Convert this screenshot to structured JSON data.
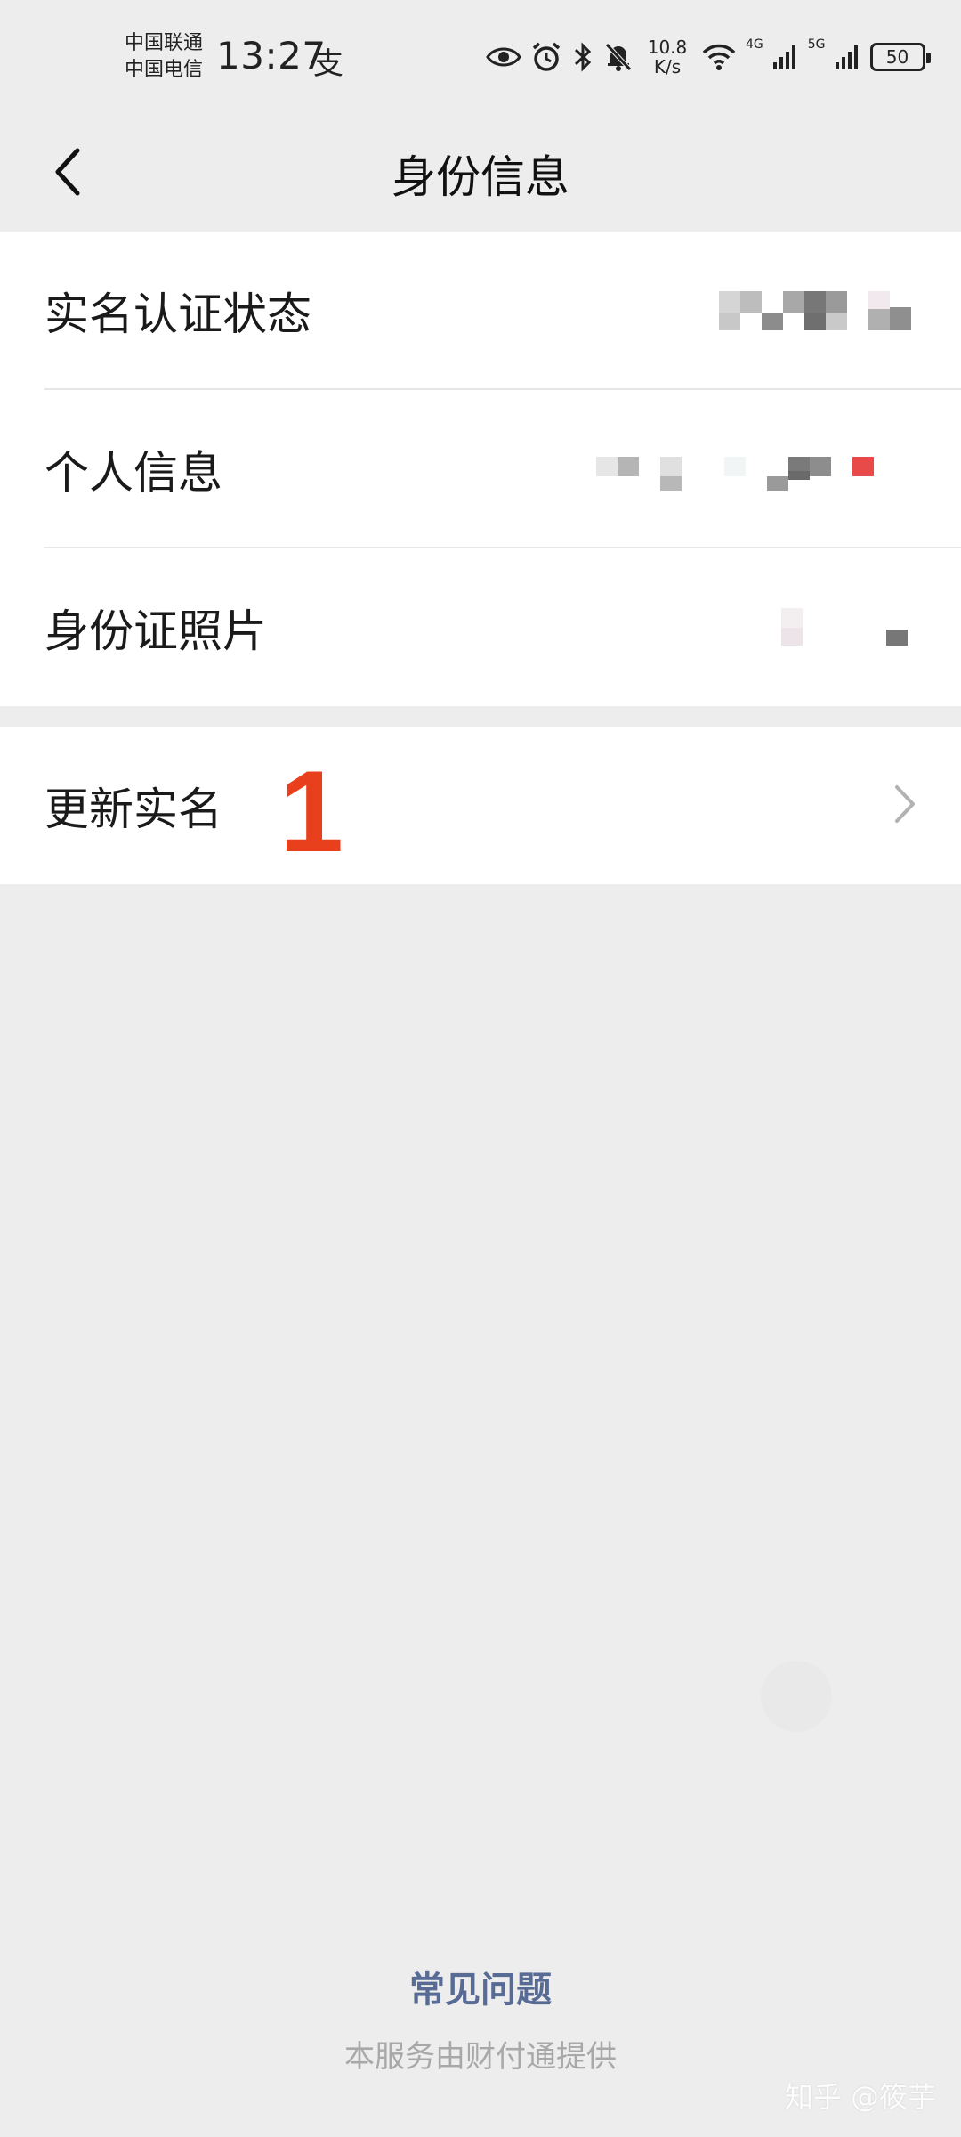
{
  "status_bar": {
    "carrier_1": "中国联通",
    "carrier_2": "中国电信",
    "time": "13:27",
    "alipay_glyph": "支",
    "net_speed_value": "10.8",
    "net_speed_unit": "K/s",
    "signal_1_label": "4G",
    "signal_2_label": "5G",
    "battery": "50",
    "icons": [
      "eye-icon",
      "alarm-icon",
      "bluetooth-icon",
      "bell-off-icon",
      "wifi-icon",
      "signal-icon",
      "signal-icon",
      "battery-icon"
    ]
  },
  "nav": {
    "title": "身份信息",
    "back_icon": "chevron-left-icon"
  },
  "identity_group": {
    "items": [
      {
        "label": "实名认证状态"
      },
      {
        "label": "个人信息"
      },
      {
        "label": "身份证照片"
      }
    ]
  },
  "update_group": {
    "label": "更新实名",
    "step_marker": "1",
    "chevron_icon": "chevron-right-icon"
  },
  "footer": {
    "faq": "常见问题",
    "provider": "本服务由财付通提供",
    "watermark": "知乎 @筱芋"
  },
  "colors": {
    "background": "#ededed",
    "card": "#ffffff",
    "link": "#576b95",
    "marker": "#e8401c"
  }
}
